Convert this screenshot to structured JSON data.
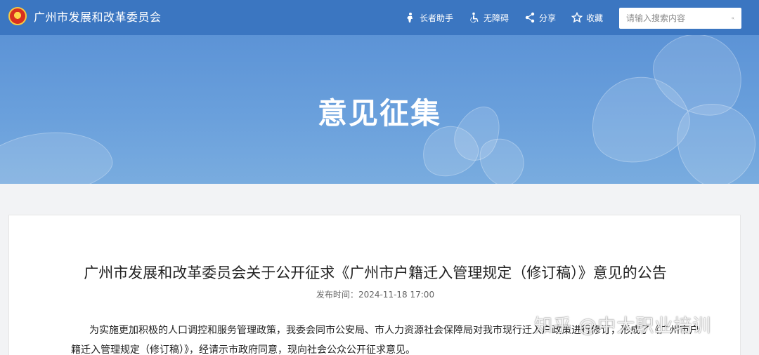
{
  "header": {
    "site_name": "广州市发展和改革委员会",
    "tools": [
      {
        "label": "长者助手",
        "icon": "elder-assist-icon"
      },
      {
        "label": "无障碍",
        "icon": "accessibility-icon"
      },
      {
        "label": "分享",
        "icon": "share-icon"
      },
      {
        "label": "收藏",
        "icon": "star-icon"
      }
    ],
    "search": {
      "placeholder": "请输入搜索内容",
      "icon": "search-icon"
    }
  },
  "banner": {
    "title": "意见征集"
  },
  "article": {
    "title": "广州市发展和改革委员会关于公开征求《广州市户籍迁入管理规定（修订稿）》意见的公告",
    "meta_label": "发布时间：",
    "publish_time": "2024-11-18 17:00",
    "paragraph": "为实施更加积极的人口调控和服务管理政策，我委会同市公安局、市人力资源社会保障局对我市现行迁入户政策进行修订，形成了《广州市户籍迁入管理规定（修订稿）》，经请示市政府同意，现向社会公众公开征求意见。"
  },
  "watermark": "知乎 @中大职业培训",
  "colors": {
    "topbar": "#3b76c1",
    "banner": "#6aa0dc",
    "page_bg": "#f2f3f5"
  }
}
